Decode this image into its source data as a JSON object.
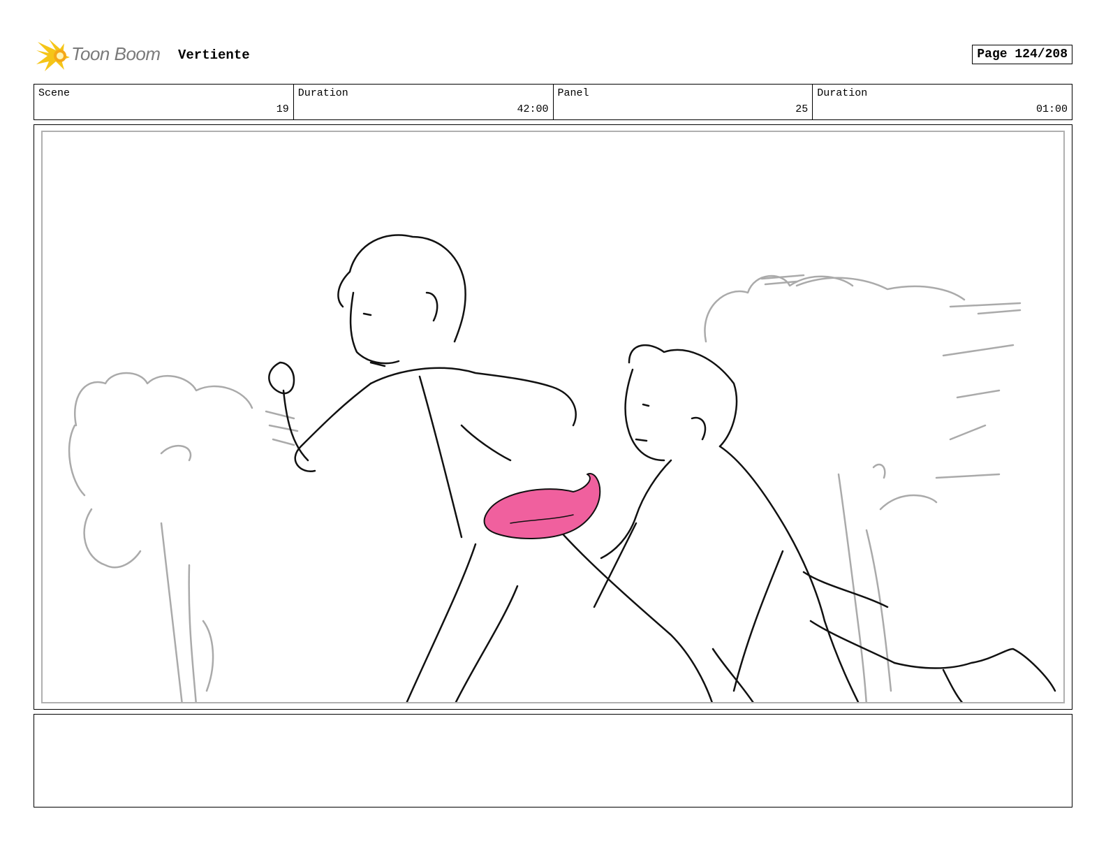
{
  "header": {
    "logo_text": "Toon Boom",
    "project_title": "Vertiente",
    "page_label": "Page 124/208"
  },
  "info": {
    "scene_label": "Scene",
    "scene_value": "19",
    "scene_duration_label": "Duration",
    "scene_duration_value": "42:00",
    "panel_label": "Panel",
    "panel_value": "25",
    "panel_duration_label": "Duration",
    "panel_duration_value": "01:00"
  },
  "colors": {
    "logo_yellow": "#f5c518",
    "logo_text": "#7a7a7a",
    "sketch_line": "#111111",
    "background_sketch": "#aaaaaa",
    "highlight_pink": "#f0609e"
  },
  "icons": {
    "logo": "toon-boom-logo-icon"
  }
}
